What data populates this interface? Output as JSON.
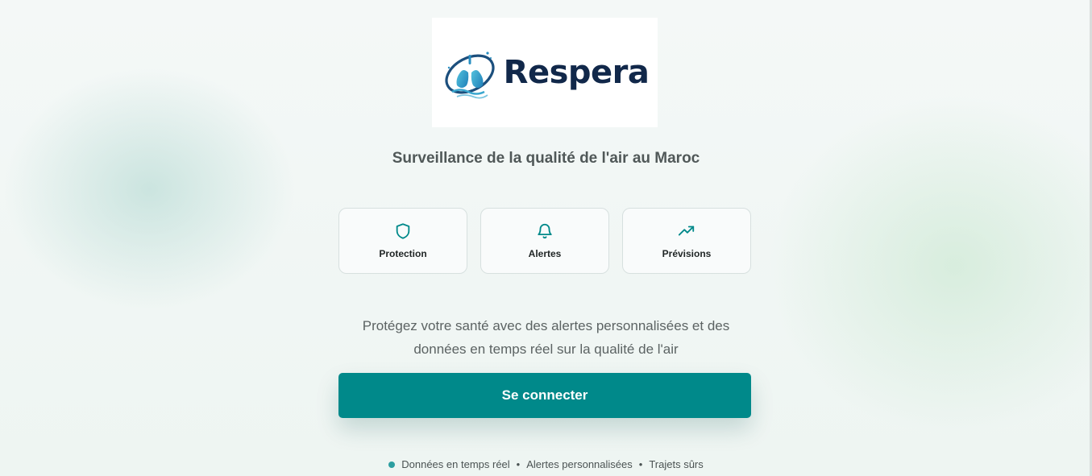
{
  "brand": {
    "name": "Respera",
    "logo_icon": "lungs-globe-icon",
    "colors": {
      "primary": "#00898a",
      "logo_text": "#11284a"
    }
  },
  "tagline": "Surveillance de la qualité de l'air au Maroc",
  "features": [
    {
      "label": "Protection",
      "icon": "shield-icon"
    },
    {
      "label": "Alertes",
      "icon": "bell-icon"
    },
    {
      "label": "Prévisions",
      "icon": "trending-up-icon"
    }
  ],
  "description": {
    "line1": "Protégez votre santé avec des alertes personnalisées et des",
    "line2": "données en temps réel sur la qualité de l'air"
  },
  "cta_label": "Se connecter",
  "footer": {
    "items": [
      "Données en temps réel",
      "Alertes personnalisées",
      "Trajets sûrs"
    ],
    "separator": "•"
  }
}
